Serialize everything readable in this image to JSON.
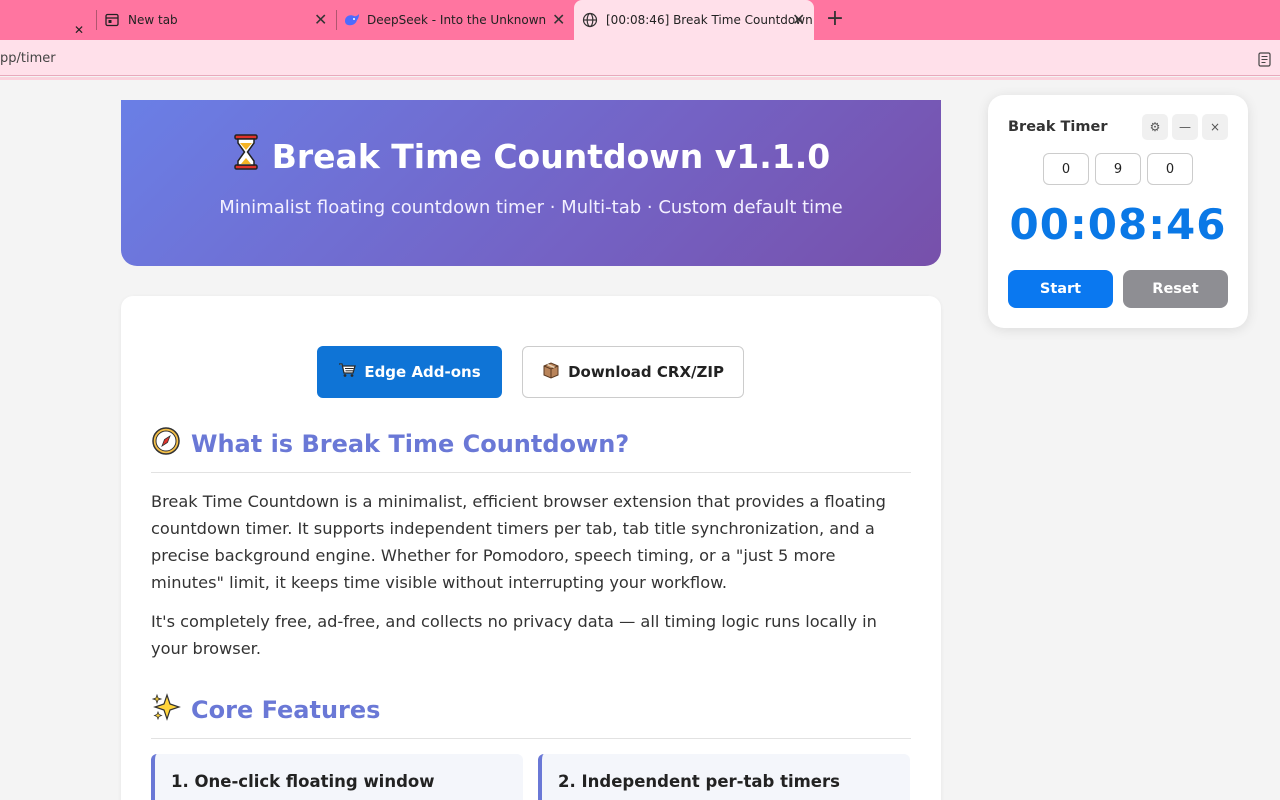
{
  "browser": {
    "tabs": [
      {
        "label": "New tab",
        "close": "✕"
      },
      {
        "label": "DeepSeek - Into the Unknown",
        "close": "✕"
      },
      {
        "label": "[00:08:46] Break Time Countdown",
        "close": "✕"
      }
    ],
    "first_tab_close": "✕",
    "new_tab": "+",
    "url": "pp/timer"
  },
  "hero": {
    "title": "Break Time Countdown v1.1.0",
    "subtitle": "Minimalist floating countdown timer · Multi-tab · Custom default time"
  },
  "buttons": {
    "edge": "Edge Add-ons",
    "download": "Download CRX/ZIP"
  },
  "about": {
    "heading": "What is Break Time Countdown?",
    "para1": "Break Time Countdown is a minimalist, efficient browser extension that provides a floating countdown timer. It supports independent timers per tab, tab title synchronization, and a precise background engine. Whether for Pomodoro, speech timing, or a \"just 5 more minutes\" limit, it keeps time visible without interrupting your workflow.",
    "para2": "It's completely free, ad-free, and collects no privacy data — all timing logic runs locally in your browser."
  },
  "features": {
    "heading": "Core Features",
    "items": [
      "1. One-click floating window",
      "2. Independent per-tab timers"
    ]
  },
  "timer": {
    "title": "Break Timer",
    "settings": "⚙",
    "minimize": "—",
    "close": "×",
    "hours": "0",
    "minutes": "9",
    "seconds": "0",
    "display": "00:08:46",
    "start": "Start",
    "reset": "Reset"
  }
}
